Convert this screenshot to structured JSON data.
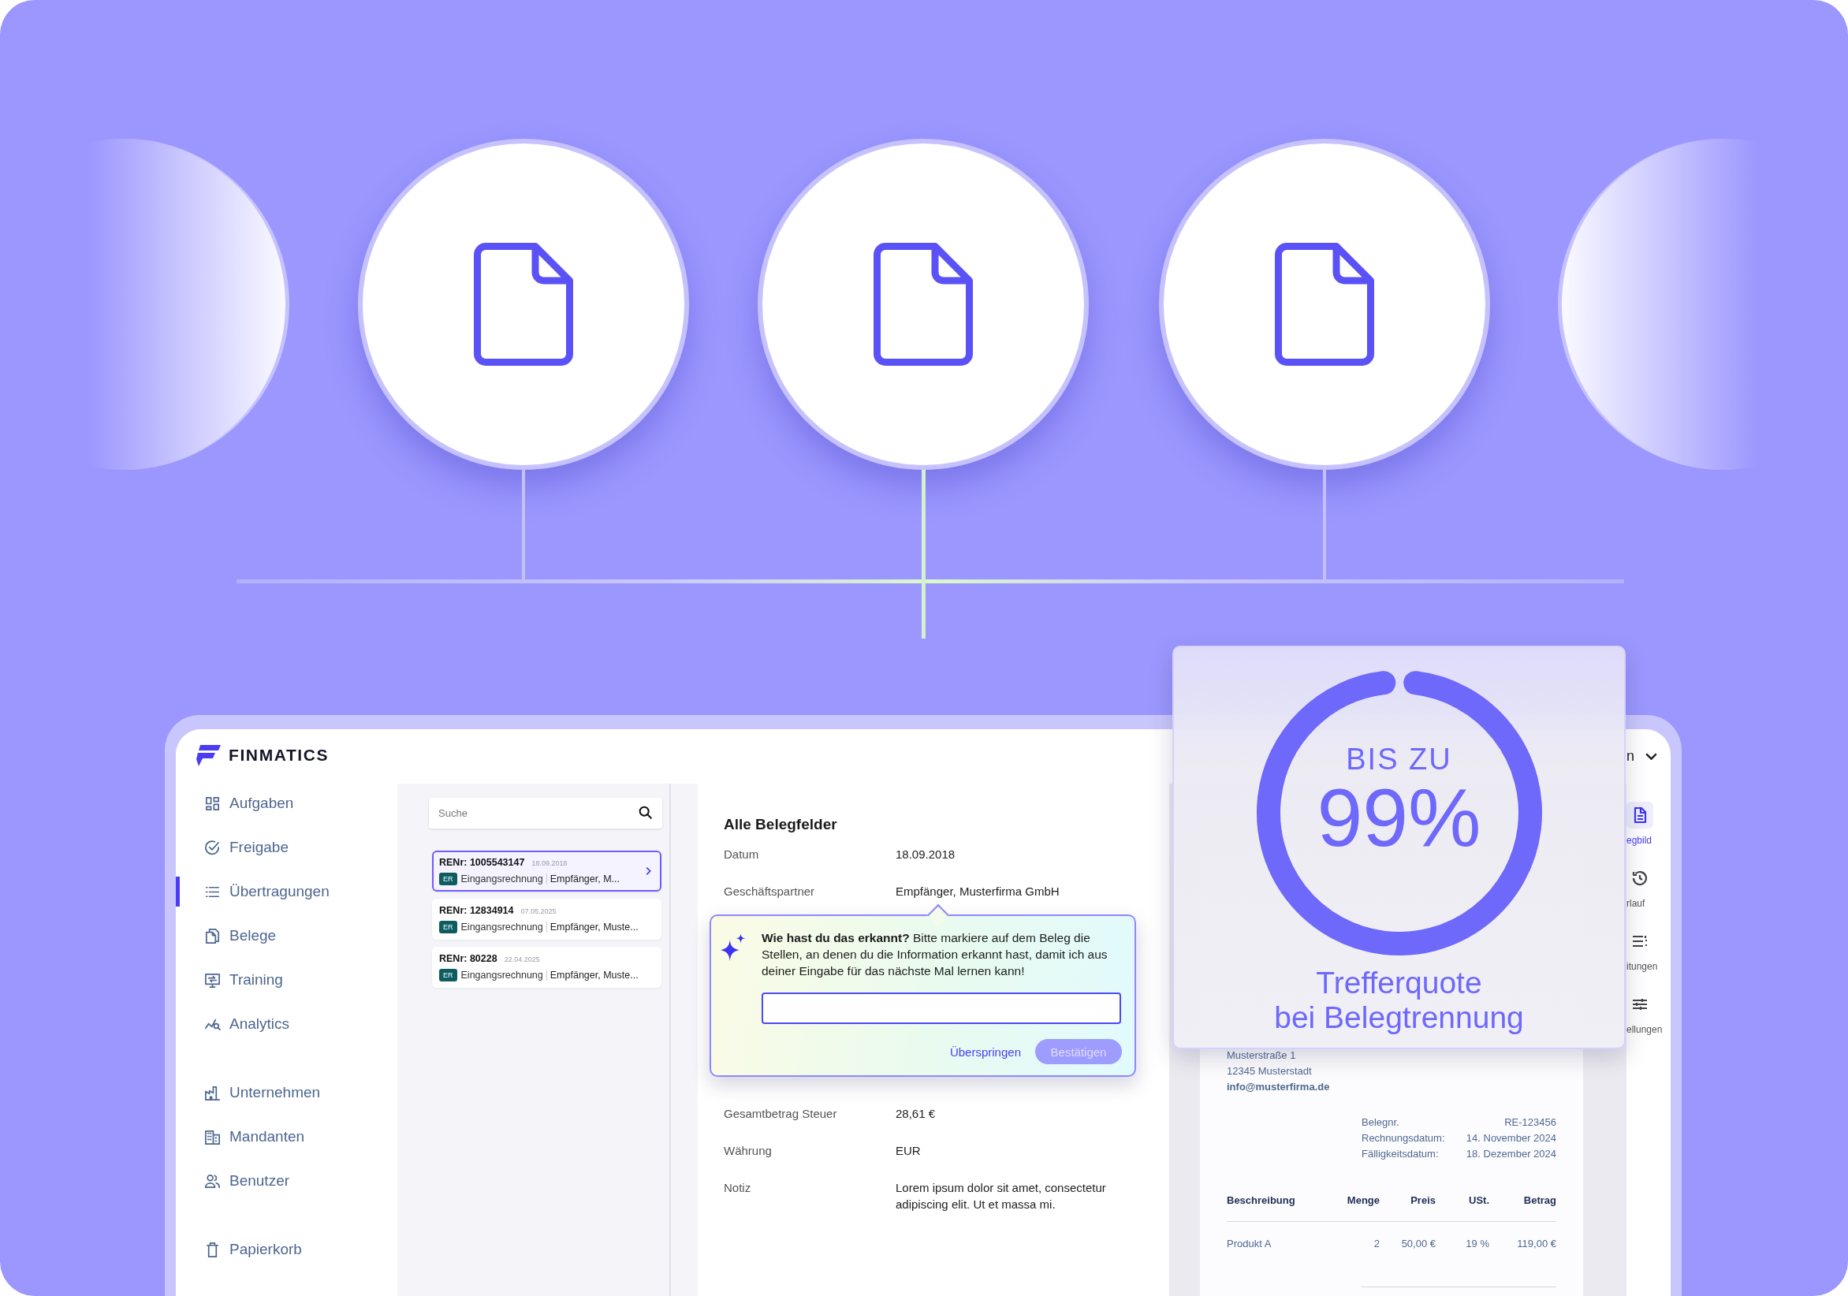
{
  "hero": {
    "circles": [
      {
        "kind": "faded"
      },
      {
        "kind": "document"
      },
      {
        "kind": "document"
      },
      {
        "kind": "document"
      },
      {
        "kind": "faded"
      }
    ]
  },
  "app": {
    "brand": "FINMATICS",
    "sidebar": {
      "groups": [
        {
          "items": [
            {
              "label": "Aufgaben",
              "selected": false
            },
            {
              "label": "Freigabe",
              "selected": false
            },
            {
              "label": "Übertragungen",
              "selected": true
            },
            {
              "label": "Belege",
              "selected": false
            },
            {
              "label": "Training",
              "selected": false
            },
            {
              "label": "Analytics",
              "selected": false
            }
          ]
        },
        {
          "items": [
            {
              "label": "Unternehmen",
              "selected": false
            },
            {
              "label": "Mandanten",
              "selected": false
            },
            {
              "label": "Benutzer",
              "selected": false
            }
          ]
        },
        {
          "items": [
            {
              "label": "Papierkorb",
              "selected": false
            }
          ]
        }
      ]
    },
    "account": {
      "label": "n"
    },
    "search": {
      "placeholder": "Suche"
    },
    "documents": [
      {
        "number": "RENr: 1005543147",
        "date": "18.09.2018",
        "badge": "ER",
        "type": "Eingangsrechnung",
        "partner": "Empfänger, M...",
        "selected": true
      },
      {
        "number": "RENr: 12834914",
        "date": "07.05.2025",
        "badge": "ER",
        "type": "Eingangsrechnung",
        "partner": "Empfänger, Muste...",
        "selected": false
      },
      {
        "number": "RENr: 80228",
        "date": "22.04.2025",
        "badge": "ER",
        "type": "Eingangsrechnung",
        "partner": "Empfänger, Muste...",
        "selected": false
      }
    ],
    "detail": {
      "title": "Alle Belegfelder",
      "fields": [
        {
          "label": "Datum",
          "value": "18.09.2018"
        },
        {
          "label": "Geschäftspartner",
          "value": "Empfänger, Musterfirma GmbH",
          "popup": {
            "text": "**Wie hast du das erkannt?** Bitte markiere auf dem Beleg die Stellen, an denen du die Information erkannt hast, damit ich aus deiner Eingabe für das nächste Mal lernen kann!",
            "skip": "Überspringen",
            "confirm": {
              "label": "Bestätigen",
              "disabled": true
            }
          }
        },
        {
          "label": "Gesamtbetrag Steuer",
          "value": "28,61 €"
        },
        {
          "label": "Währung",
          "value": "EUR"
        },
        {
          "label": "Notiz",
          "value": "Lorem ipsum dolor sit amet, consectetur adipiscing elit. Ut et massa mi."
        }
      ]
    },
    "preview": {
      "address": [
        "Musterstraße 1",
        "12345 Musterstadt"
      ],
      "email": "info@musterfirma.de",
      "meta": [
        {
          "label": "Belegnr.",
          "value": "RE-123456"
        },
        {
          "label": "Rechnungsdatum:",
          "value": "14. November 2024"
        },
        {
          "label": "Fälligkeitsdatum:",
          "value": "18. Dezember 2024"
        }
      ],
      "table": {
        "columns": [
          "Beschreibung",
          "Menge",
          "Preis",
          "USt.",
          "Betrag"
        ],
        "rows": [
          [
            "Produkt A",
            "2",
            "50,00 €",
            "19 %",
            "119,00 €"
          ]
        ]
      }
    },
    "toolbar": {
      "tools": [
        {
          "label": "egbild",
          "selected": true
        },
        {
          "label": "rlauf",
          "selected": false
        },
        {
          "label": "itungen",
          "selected": false
        },
        {
          "label": "ellungen",
          "selected": false
        }
      ]
    }
  },
  "stat": {
    "prefix": "BIS ZU",
    "value": "99%",
    "level": 0.99,
    "caption": [
      "Trefferquote",
      "bei Belegtrennung"
    ]
  }
}
